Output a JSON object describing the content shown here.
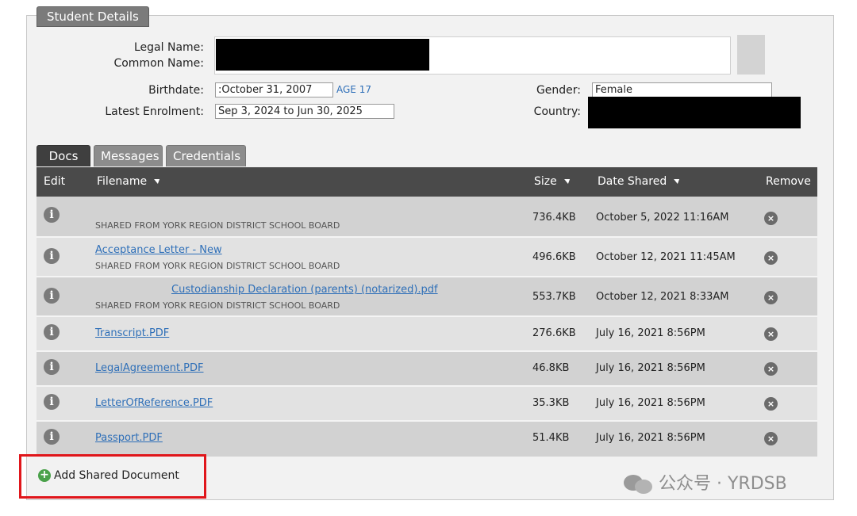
{
  "panel": {
    "title": "Student Details"
  },
  "student": {
    "legal_name_label": "Legal Name:",
    "common_name_label": "Common Name:",
    "birthdate_label": "Birthdate:",
    "birthdate_value": ":October 31, 2007",
    "age": "AGE 17",
    "latest_enrolment_label": "Latest Enrolment:",
    "latest_enrolment_value": "Sep 3, 2024 to Jun 30, 2025",
    "gender_label": "Gender:",
    "gender_value": "Female",
    "country_label": "Country:"
  },
  "tabs": [
    {
      "label": "Docs",
      "active": true
    },
    {
      "label": "Messages",
      "active": false
    },
    {
      "label": "Credentials",
      "active": false
    }
  ],
  "table": {
    "headers": {
      "edit": "Edit",
      "filename": "Filename",
      "size": "Size",
      "date_shared": "Date Shared",
      "remove": "Remove"
    },
    "rows": [
      {
        "filename": "",
        "source": "SHARED FROM YORK REGION DISTRICT SCHOOL BOARD",
        "size": "736.4KB",
        "date": "October 5, 2022 11:16AM"
      },
      {
        "filename": "Acceptance Letter - New",
        "source": "SHARED FROM YORK REGION DISTRICT SCHOOL BOARD",
        "size": "496.6KB",
        "date": "October 12, 2021 11:45AM"
      },
      {
        "filename": "Custodianship Declaration (parents) (notarized).pdf",
        "source": "SHARED FROM YORK REGION DISTRICT SCHOOL BOARD",
        "size": "553.7KB",
        "date": "October 12, 2021 8:33AM"
      },
      {
        "filename": "Transcript.PDF",
        "source": "",
        "size": "276.6KB",
        "date": "July 16, 2021 8:56PM"
      },
      {
        "filename": "LegalAgreement.PDF",
        "source": "",
        "size": "46.8KB",
        "date": "July 16, 2021 8:56PM"
      },
      {
        "filename": "LetterOfReference.PDF",
        "source": "",
        "size": "35.3KB",
        "date": "July 16, 2021 8:56PM"
      },
      {
        "filename": "Passport.PDF",
        "source": "",
        "size": "51.4KB",
        "date": "July 16, 2021 8:56PM"
      }
    ]
  },
  "icons": {
    "info": "i",
    "remove": "×",
    "add": "+"
  },
  "actions": {
    "add_shared_document": "Add Shared Document"
  },
  "watermark": {
    "text": "公众号 · YRDSB"
  },
  "colors": {
    "link": "#2e6fb8",
    "header_bg": "#4a4a4a",
    "highlight": "#e0161b",
    "add_icon": "#4aa14a"
  }
}
